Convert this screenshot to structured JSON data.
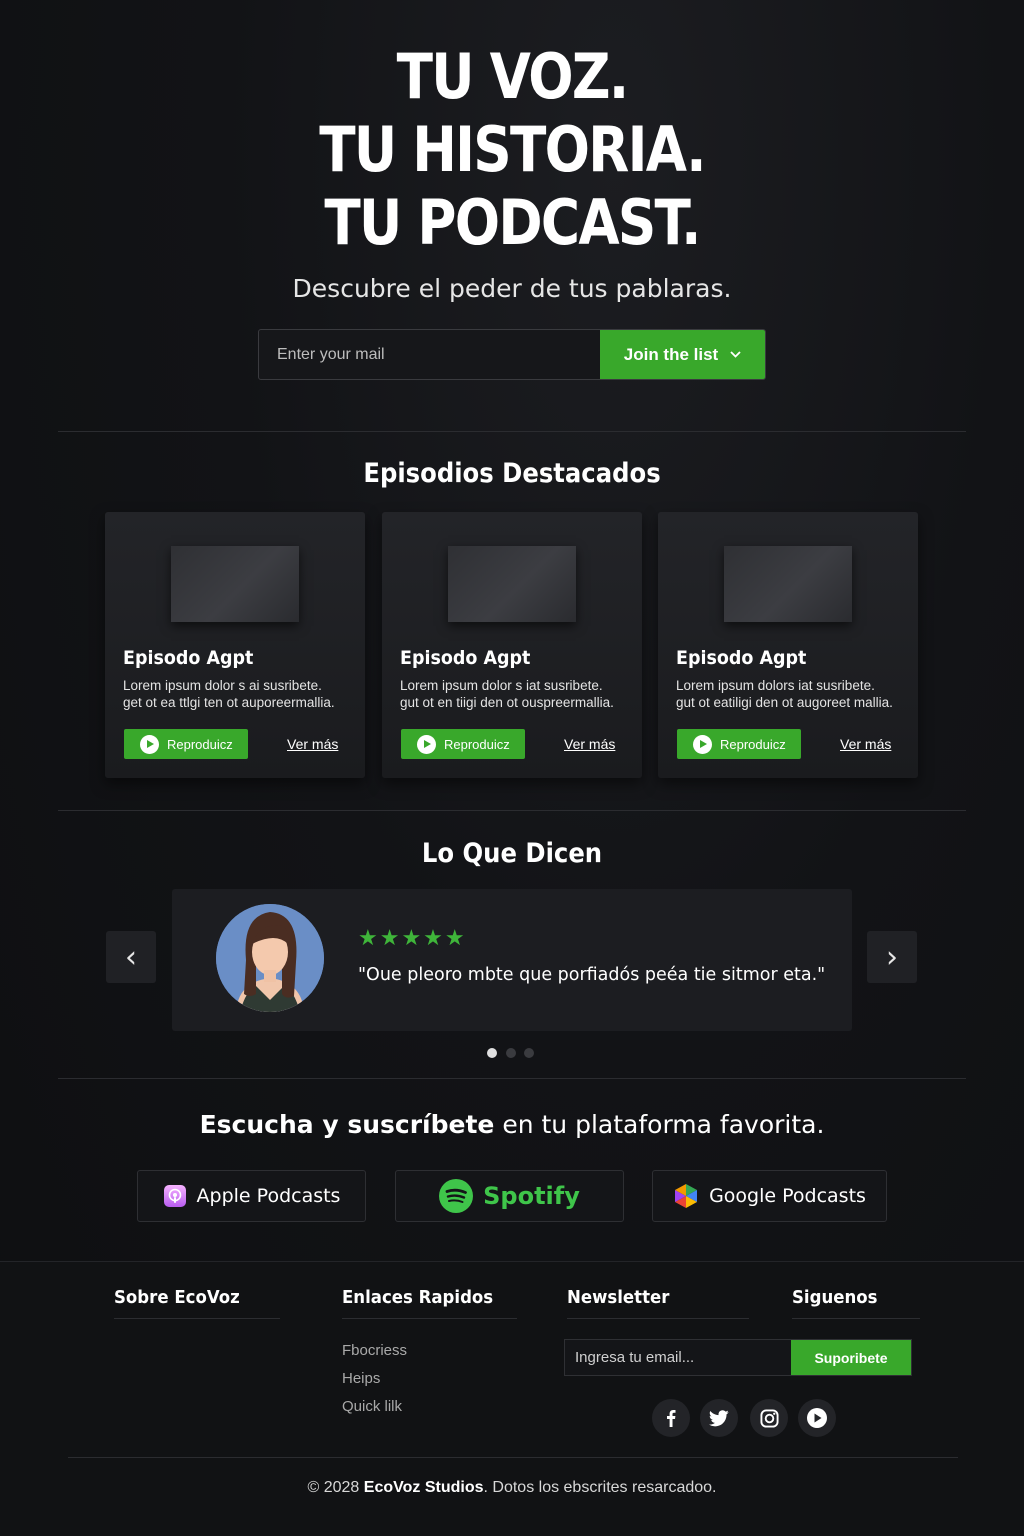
{
  "hero": {
    "line1": "TU VOZ.",
    "line2": "TU HISTORIA.",
    "line3": "TU PODCAST.",
    "subtitle": "Descubre el peder de tus pablaras.",
    "email_placeholder": "Enter your mail",
    "join_label": "Join the list"
  },
  "episodes": {
    "title": "Episodios Destacados",
    "items": [
      {
        "title": "Episodo Agpt",
        "desc1": "Lorem ipsum dolor s ai susribete.",
        "desc2": "get ot ea ttlgi ten ot auporeermallia.",
        "play_label": "Reproduicz",
        "more_label": "Ver más"
      },
      {
        "title": "Episodo Agpt",
        "desc1": "Lorem ipsum dolor s iat susribete.",
        "desc2": "gut ot en tiigi den ot ouspreermallia.",
        "play_label": "Reproduicz",
        "more_label": "Ver más"
      },
      {
        "title": "Episodo Agpt",
        "desc1": "Lorem ipsum dolors iat susribete.",
        "desc2": "gut ot eatiligi den ot augoreet mallia.",
        "play_label": "Reproduicz",
        "more_label": "Ver más"
      }
    ]
  },
  "testimonials": {
    "title": "Lo Que Dicen",
    "stars": "★★★★★",
    "rating": 5,
    "quote": "\"Oue pleoro mbte que porfiadós peéa tie sitmor eta.\"",
    "prev_icon": "‹",
    "next_icon": "›",
    "active_index": 0,
    "count": 3
  },
  "platforms": {
    "cta_bold": "Escucha y suscríbete",
    "cta_rest": " en tu plataforma favorita.",
    "apple": "Apple Podcasts",
    "spotify": "Spotify",
    "google": "Google Podcasts"
  },
  "footer": {
    "about_title": "Sobre EcoVoz",
    "links_title": "Enlaces Rapidos",
    "links": [
      "Fbocriess",
      "Heips",
      "Quick lilk"
    ],
    "newsletter_title": "Newsletter",
    "newsletter_placeholder": "Ingresa tu email...",
    "subscribe_label": "Suporibete",
    "social_title": "Siguenos",
    "copyright_pre": "© 2028 ",
    "copyright_brand": "EcoVoz Studios",
    "copyright_post": ". Dotos los ebscrites resarcadoo."
  },
  "colors": {
    "accent": "#39a82b",
    "background": "#121316",
    "star": "#3fb53a"
  }
}
